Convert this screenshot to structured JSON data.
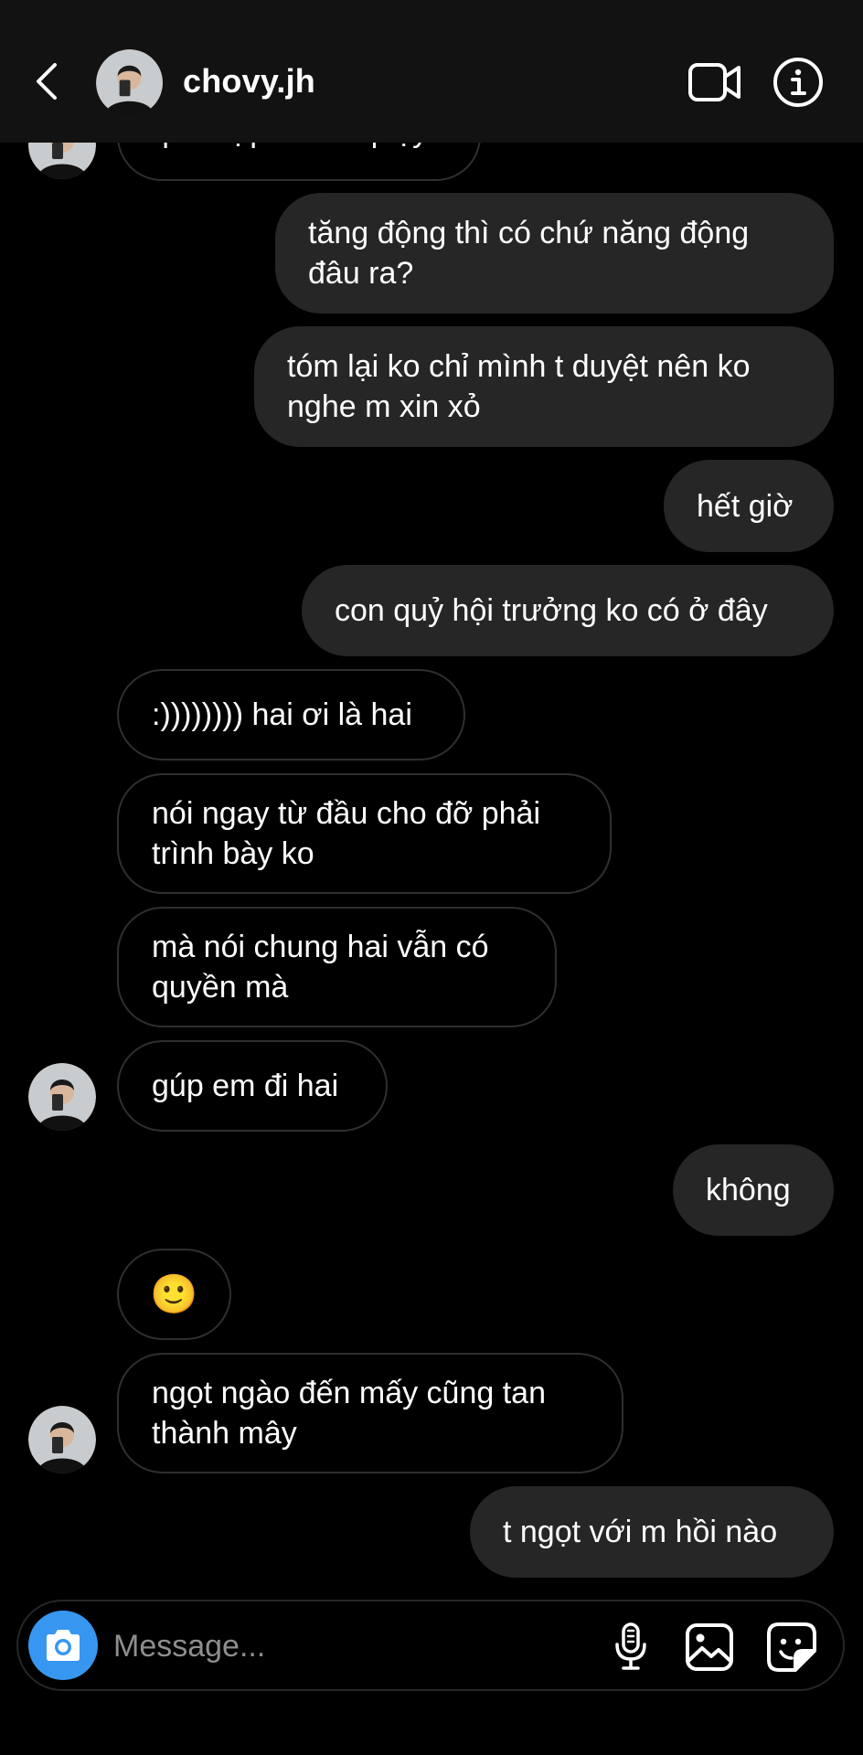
{
  "header": {
    "username": "chovy.jh"
  },
  "messages": [
    {
      "dir": "in",
      "text": "quá hợp để về quậy",
      "partial": true
    },
    {
      "dir": "out",
      "lines": [
        "tăng động thì có chứ năng động",
        "đâu ra?"
      ]
    },
    {
      "dir": "out",
      "lines": [
        "tóm lại ko chỉ mình t duyệt nên ko",
        "nghe m xin xỏ"
      ]
    },
    {
      "dir": "out",
      "text": "hết giờ"
    },
    {
      "dir": "out",
      "text": "con quỷ hội trưởng ko có ở đây"
    },
    {
      "dir": "in",
      "text": ":)))))))) hai ơi là hai"
    },
    {
      "dir": "in",
      "lines": [
        "nói ngay từ đầu cho đỡ phải",
        "trình bày ko"
      ]
    },
    {
      "dir": "in",
      "lines": [
        "mà nói chung hai vẫn có",
        "quyền mà"
      ]
    },
    {
      "dir": "in",
      "text": "gúp em đi hai"
    },
    {
      "dir": "out",
      "text": "không"
    },
    {
      "dir": "in",
      "text": "🙂"
    },
    {
      "dir": "in",
      "lines": [
        "ngọt ngào đến mấy cũng tan",
        "thành mây"
      ]
    },
    {
      "dir": "out",
      "text": "t ngọt với m hồi nào"
    }
  ],
  "composer": {
    "placeholder": "Message..."
  },
  "colors": {
    "background": "#000000",
    "header_bg": "#121212",
    "outgoing_bubble": "#262626",
    "incoming_border": "#2f2f2f",
    "camera_button": "#3797f0",
    "placeholder": "#8e8e8e"
  },
  "icons": [
    "back-arrow-icon",
    "video-call-icon",
    "info-icon",
    "camera-icon",
    "microphone-icon",
    "gallery-icon",
    "sticker-icon"
  ]
}
